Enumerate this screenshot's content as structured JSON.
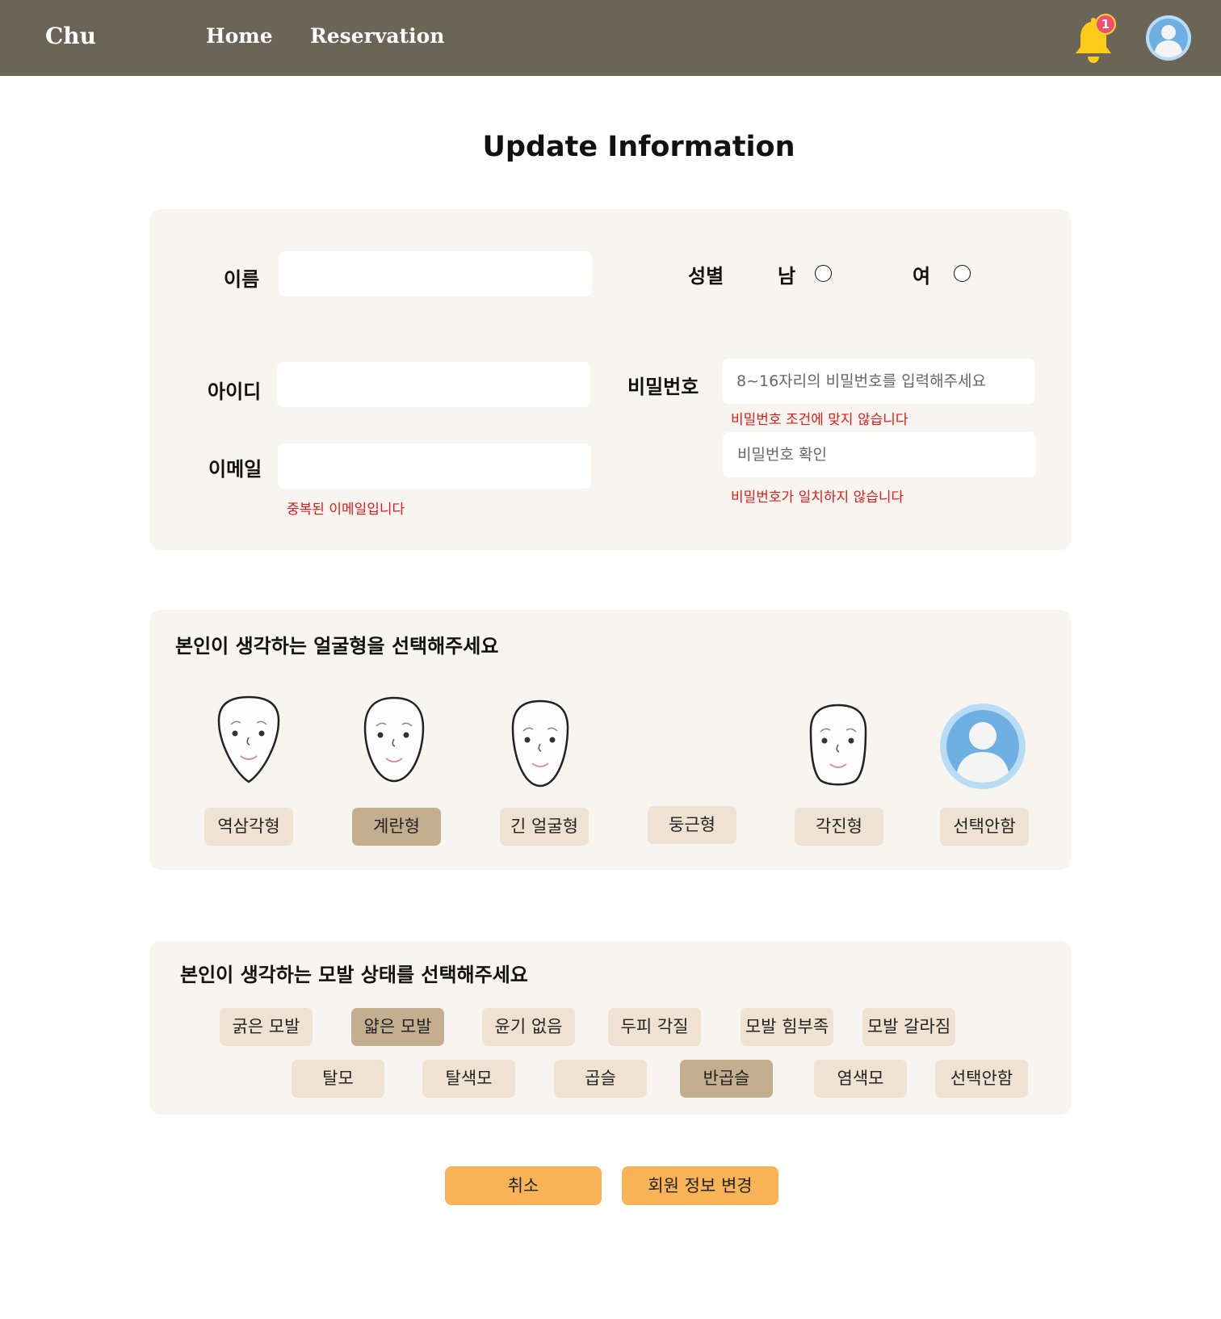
{
  "nav": {
    "brand": "Chu",
    "links": [
      "Home",
      "Reservation"
    ],
    "notification_count": "1",
    "icons": {
      "notification": "bell-icon",
      "profile": "user-avatar-icon"
    }
  },
  "page_title": "Update Information",
  "account": {
    "name_label": "이름",
    "name_value": "",
    "gender_label": "성별",
    "gender_options": [
      "남",
      "여"
    ],
    "id_label": "아이디",
    "id_value": "",
    "email_label": "이메일",
    "email_value": "",
    "email_error": "중복된 이메일입니다",
    "password_label": "비밀번호",
    "password_placeholder": "8~16자리의 비밀번호를 입력해주세요",
    "password_error": "비밀번호 조건에 맞지 않습니다",
    "password_confirm_placeholder": "비밀번호 확인",
    "password_confirm_error": "비밀번호가 일치하지 않습니다"
  },
  "face_shape": {
    "title": "본인이 생각하는 얼굴형을 선택해주세요",
    "options": [
      {
        "label": "역삼각형",
        "selected": false,
        "icon": "inverted-triangle-face-icon"
      },
      {
        "label": "계란형",
        "selected": true,
        "icon": "oval-face-icon"
      },
      {
        "label": "긴 얼굴형",
        "selected": false,
        "icon": "long-face-icon"
      },
      {
        "label": "둥근형",
        "selected": false,
        "icon": ""
      },
      {
        "label": "각진형",
        "selected": false,
        "icon": "square-face-icon"
      },
      {
        "label": "선택안함",
        "selected": false,
        "icon": "user-avatar-icon"
      }
    ]
  },
  "hair_condition": {
    "title": "본인이 생각하는 모발 상태를 선택해주세요",
    "options": [
      {
        "label": "굵은 모발",
        "selected": false
      },
      {
        "label": "얇은 모발",
        "selected": true
      },
      {
        "label": "윤기 없음",
        "selected": false
      },
      {
        "label": "두피 각질",
        "selected": false
      },
      {
        "label": "모발 힘부족",
        "selected": false
      },
      {
        "label": "모발 갈라짐",
        "selected": false
      },
      {
        "label": "탈모",
        "selected": false
      },
      {
        "label": "탈색모",
        "selected": false
      },
      {
        "label": "곱슬",
        "selected": false
      },
      {
        "label": "반곱슬",
        "selected": true
      },
      {
        "label": "염색모",
        "selected": false
      },
      {
        "label": "선택안함",
        "selected": false
      }
    ]
  },
  "actions": {
    "cancel": "취소",
    "submit": "회원 정보 변경"
  },
  "colors": {
    "header": "#6b6558",
    "card": "#f8f5f1",
    "chip": "#efe2d2",
    "chip_selected": "#c4ae90",
    "button": "#f7b356",
    "error": "#e01a1a",
    "avatar": "#6fb0e3"
  }
}
